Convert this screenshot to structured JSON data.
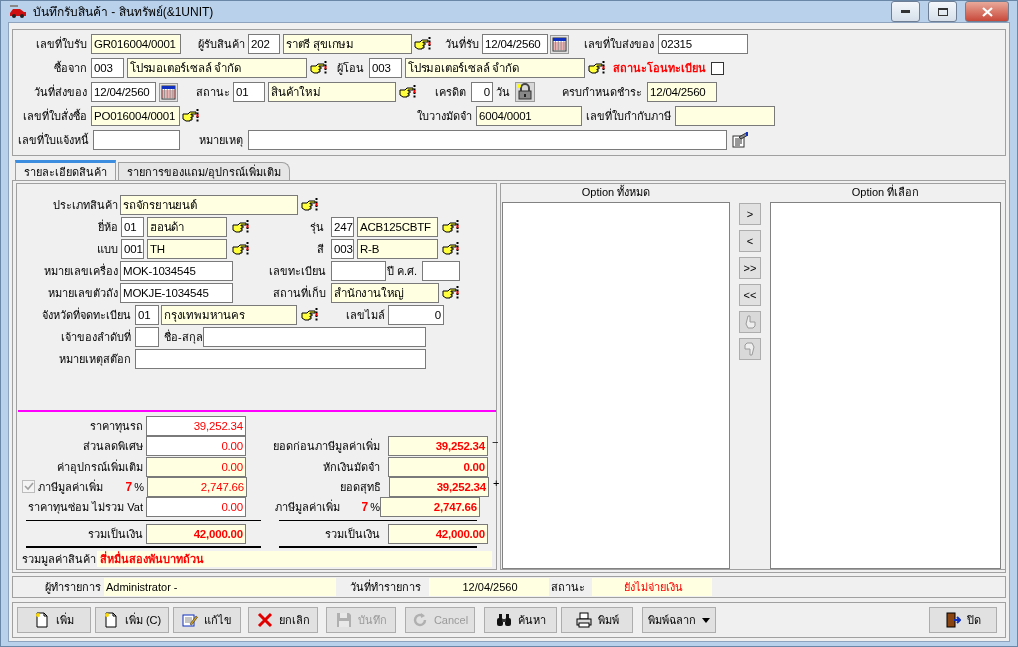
{
  "window": {
    "title": "บันทึกรับสินค้า - สินทรัพย์(&1UNIT)"
  },
  "header": {
    "receipt_no": {
      "label": "เลขที่ใบรับ",
      "value": "GR016004/0001",
      "readonly": true
    },
    "receiver": {
      "label": "ผู้รับสินค้า",
      "code": "202",
      "name": "ราตรี สุขเกษม"
    },
    "receive_date": {
      "label": "วันที่รับ",
      "value": "12/04/2560"
    },
    "delivery_no": {
      "label": "เลขที่ใบส่งของ",
      "value": "02315",
      "readonly": false
    },
    "supplier": {
      "label": "ซื้อจาก",
      "code": "003",
      "name": "โปรมอเตอร์เซลล์ จำกัด"
    },
    "transferor": {
      "label": "ผู้โอน",
      "code": "003",
      "name": "โปรมอเตอร์เซลล์ จำกัด"
    },
    "transfer_status": {
      "label": "สถานะโอนทะเบียน",
      "checked": false
    },
    "delivery_date": {
      "label": "วันที่ส่งของ",
      "value": "12/04/2560"
    },
    "status": {
      "label": "สถานะ",
      "code": "01",
      "name": "สินค้าใหม่"
    },
    "credit": {
      "label": "เครดิต",
      "value": "0",
      "unit": "วัน",
      "locked": true
    },
    "due_date": {
      "label": "ครบกำหนดชำระ",
      "value": "12/04/2560",
      "readonly": true
    },
    "po_no": {
      "label": "เลขที่ใบสั่งซื้อ",
      "value": "PO016004/0001",
      "readonly": true
    },
    "deposit_no": {
      "label": "ใบวางมัดจำ",
      "value": "6004/0001",
      "readonly": true
    },
    "tax_invoice_no": {
      "label": "เลขที่ใบกำกับภาษี",
      "readonly": true
    },
    "invoice_no": {
      "label": "เลขที่ใบแจ้งหนี้",
      "readonly": false
    },
    "remark": {
      "label": "หมายเหตุ",
      "readonly": false
    }
  },
  "tabs": [
    {
      "label": "รายละเอียดสินค้า",
      "selected": true
    },
    {
      "label": "รายการของแถม/อุปกรณ์เพิ่มเติม",
      "selected": false
    }
  ],
  "details": {
    "product_type": {
      "label": "ประเภทสินค้า",
      "value": "รถจักรยานยนต์"
    },
    "brand": {
      "label": "ยี่ห้อ",
      "code": "01",
      "name": "ฮอนด้า"
    },
    "model": {
      "label": "รุ่น",
      "code": "247",
      "name": "ACB125CBTF"
    },
    "variant": {
      "label": "แบบ",
      "code": "001",
      "name": "TH"
    },
    "color": {
      "label": "สี",
      "code": "003",
      "name": "R-B"
    },
    "engine_no": {
      "label": "หมายเลขเครื่อง",
      "value": "MOK-1034545"
    },
    "plate_no": {
      "label": "เลขทะเบียน"
    },
    "year": {
      "label": "ปี ค.ศ."
    },
    "chassis_no": {
      "label": "หมายเลขตัวถัง",
      "value": "MOKJE-1034545"
    },
    "location": {
      "label": "สถานที่เก็บ",
      "value": "สำนักงานใหญ่"
    },
    "province": {
      "label": "จังหวัดที่จดทะเบียน",
      "code": "01",
      "name": "กรุงเทพมหานคร"
    },
    "mileage": {
      "label": "เลขไมล์",
      "value": "0"
    },
    "owner_seq": {
      "label": "เจ้าของลำดับที่"
    },
    "owner_name": {
      "label": "ชื่อ-สกุล"
    },
    "stock_remark": {
      "label": "หมายเหตุสต๊อก"
    }
  },
  "costs": {
    "left": [
      {
        "label": "ราคาทุนรถ",
        "value": "39,252.34",
        "readonly": false
      },
      {
        "label": "ส่วนลดพิเศษ",
        "value": "0.00",
        "readonly": false
      },
      {
        "label": "ค่าอุปกรณ์เพิ่มเติม",
        "value": "0.00",
        "readonly": true
      },
      {
        "label": "ภาษีมูลค่าเพิ่ม",
        "value": "2,747.66",
        "readonly": true,
        "checked": true,
        "disabled": true,
        "rate": "7",
        "unit": "%"
      },
      {
        "label": "ราคาทุนซ่อม ไม่รวม Vat",
        "value": "0.00",
        "readonly": false
      }
    ],
    "left_total": {
      "label": "รวมเป็นเงิน",
      "value": "42,000.00"
    },
    "right": [
      {
        "label": "ยอดก่อนภาษีมูลค่าเพิ่ม",
        "value": "39,252.34",
        "sign": "−"
      },
      {
        "label": "หักเงินมัดจำ",
        "value": "0.00"
      },
      {
        "label": "ยอดสุทธิ",
        "value": "39,252.34",
        "sign": "+"
      },
      {
        "label": "ภาษีมูลค่าเพิ่ม",
        "value": "2,747.66",
        "rate": "7",
        "unit": "%"
      }
    ],
    "right_total": {
      "label": "รวมเป็นเงิน",
      "value": "42,000.00"
    },
    "amount_words": {
      "label": "รวมมูลค่าสินค้า",
      "value": "สี่หมื่นสองพันบาทถ้วน"
    }
  },
  "options": {
    "all_title": "Option ทั้งหมด",
    "selected_title": "Option ที่เลือก",
    "moves": [
      {
        "label": ">",
        "disabled": false
      },
      {
        "label": "<",
        "disabled": false
      },
      {
        "label": ">>",
        "disabled": false
      },
      {
        "label": "<<",
        "disabled": false
      }
    ],
    "hand_buttons": [
      {
        "disabled": true
      },
      {
        "disabled": true
      }
    ]
  },
  "status_bar": {
    "user_label": "ผู้ทำรายการ",
    "user": "Administrator -",
    "date_label": "วันที่ทำรายการ",
    "date": "12/04/2560",
    "status_label": "สถานะ",
    "status": "ยังไม่จ่ายเงิน"
  },
  "buttons": [
    {
      "label": "เพิ่ม",
      "disabled": false
    },
    {
      "label": "เพิ่ม (C)",
      "disabled": false
    },
    {
      "label": "แก้ไข",
      "disabled": false
    },
    {
      "label": "ยกเลิก",
      "disabled": false
    },
    {
      "label": "บันทึก",
      "disabled": true
    },
    {
      "label": "Cancel",
      "disabled": true
    },
    {
      "label": "ค้นหา",
      "disabled": false
    },
    {
      "label": "พิมพ์",
      "disabled": false
    },
    {
      "label": "พิมพ์ฉลาก",
      "disabled": false
    }
  ],
  "close_button": {
    "label": "ปิด"
  }
}
